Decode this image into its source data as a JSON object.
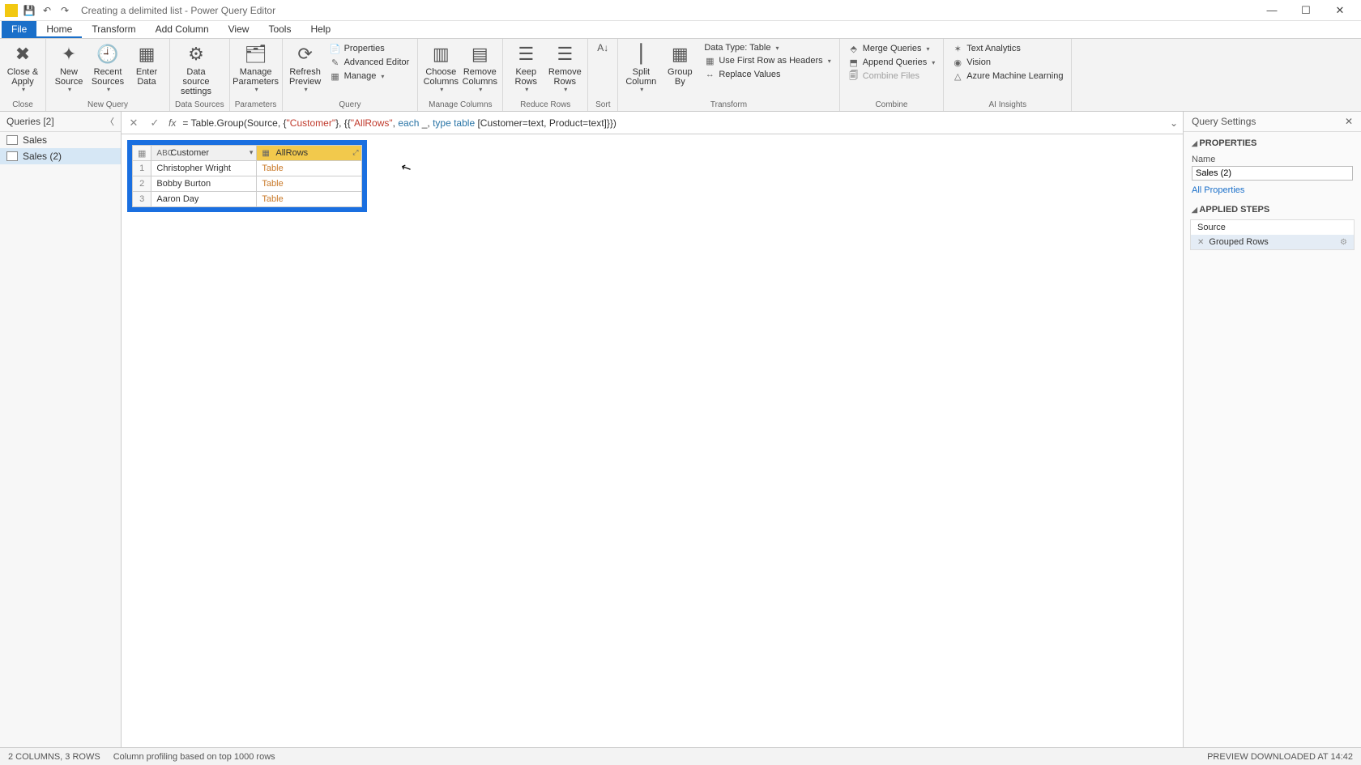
{
  "titlebar": {
    "title": "Creating a delimited list - Power Query Editor"
  },
  "menus": {
    "file": "File",
    "home": "Home",
    "transform": "Transform",
    "addcol": "Add Column",
    "view": "View",
    "tools": "Tools",
    "help": "Help"
  },
  "ribbon": {
    "close_apply": "Close &\nApply",
    "new_source": "New\nSource",
    "recent_sources": "Recent\nSources",
    "enter_data": "Enter\nData",
    "data_source_settings": "Data source\nsettings",
    "manage_params": "Manage\nParameters",
    "refresh_preview": "Refresh\nPreview",
    "properties": "Properties",
    "adv_editor": "Advanced Editor",
    "manage": "Manage",
    "choose_cols": "Choose\nColumns",
    "remove_cols": "Remove\nColumns",
    "keep_rows": "Keep\nRows",
    "remove_rows": "Remove\nRows",
    "sort": "Sort",
    "split_col": "Split\nColumn",
    "group_by": "Group\nBy",
    "data_type": "Data Type: Table",
    "first_row_headers": "Use First Row as Headers",
    "replace_values": "Replace Values",
    "merge_q": "Merge Queries",
    "append_q": "Append Queries",
    "combine_files": "Combine Files",
    "text_analytics": "Text Analytics",
    "vision": "Vision",
    "azure_ml": "Azure Machine Learning",
    "groups": {
      "close": "Close",
      "new_query": "New Query",
      "data_sources": "Data Sources",
      "parameters": "Parameters",
      "query": "Query",
      "manage_cols": "Manage Columns",
      "reduce_rows": "Reduce Rows",
      "sort": "Sort",
      "transform": "Transform",
      "combine": "Combine",
      "ai": "AI Insights"
    }
  },
  "queries": {
    "header": "Queries [2]",
    "items": [
      "Sales",
      "Sales (2)"
    ]
  },
  "formula": {
    "prefix": "= Table.Group(Source, {",
    "arg1": "\"Customer\"",
    "mid1": "}, {{",
    "arg2": "\"AllRows\"",
    "mid2": ", ",
    "each": "each",
    "mid3": " _, ",
    "type": "type",
    "mid4": " ",
    "table": "table",
    "tail": " [Customer=text, Product=text]}})"
  },
  "grid": {
    "cols": [
      "Customer",
      "AllRows"
    ],
    "rows": [
      {
        "n": "1",
        "c": "Christopher Wright",
        "v": "Table"
      },
      {
        "n": "2",
        "c": "Bobby Burton",
        "v": "Table"
      },
      {
        "n": "3",
        "c": "Aaron Day",
        "v": "Table"
      }
    ]
  },
  "settings": {
    "title": "Query Settings",
    "properties": "PROPERTIES",
    "name_label": "Name",
    "name_value": "Sales (2)",
    "all_props": "All Properties",
    "applied": "APPLIED STEPS",
    "steps": [
      "Source",
      "Grouped Rows"
    ]
  },
  "status": {
    "left": "2 COLUMNS, 3 ROWS",
    "mid": "Column profiling based on top 1000 rows",
    "right": "PREVIEW DOWNLOADED AT 14:42"
  }
}
